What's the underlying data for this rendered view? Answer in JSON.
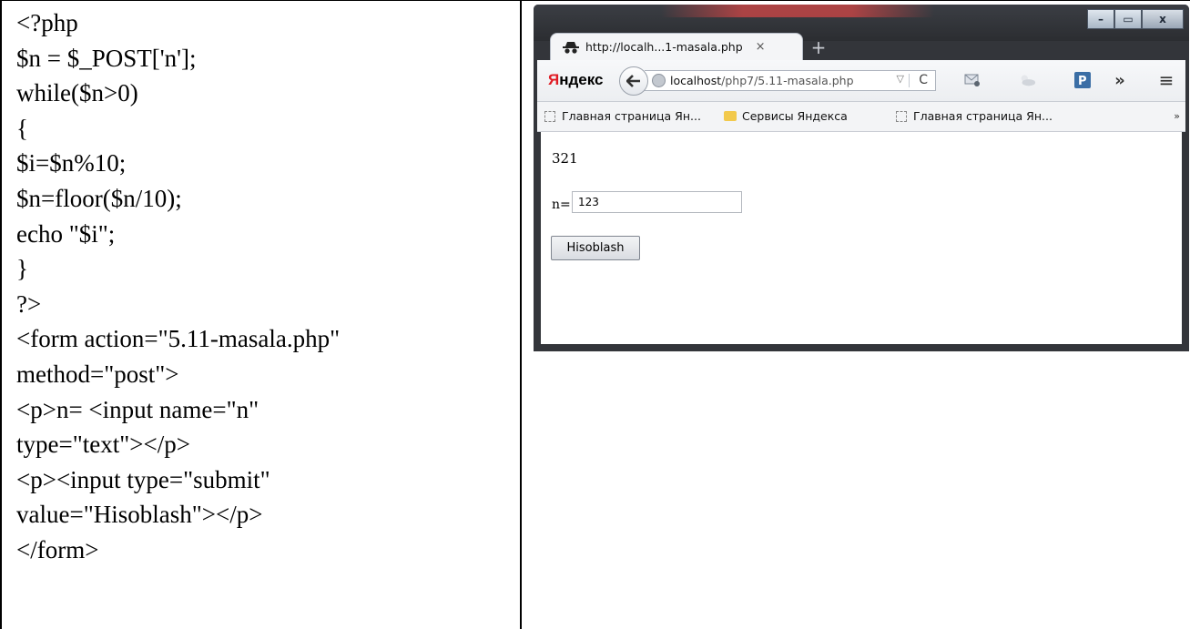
{
  "code": {
    "lines": [
      "<?php",
      "$n = $_POST['n'];",
      "while($n>0)",
      "{",
      "$i=$n%10;",
      "$n=floor($n/10);",
      "echo \"$i\";",
      "}",
      "?>",
      "<form action=\"5.11-masala.php\"",
      "method=\"post\">",
      "<p>n= <input name=\"n\"",
      "type=\"text\"></p>",
      "<p><input type=\"submit\"",
      "value=\"Hisoblash\"></p>",
      "</form>"
    ]
  },
  "browser": {
    "tab_title": "http://localh...1-masala.php",
    "tab_close": "×",
    "new_tab": "+",
    "window_controls": {
      "minimize": "–",
      "maximize": "▭",
      "close": "x"
    },
    "yandex_first": "Я",
    "yandex_rest": "ндекс",
    "url_host": "localhost",
    "url_path": "/php7/5.11-masala.php",
    "url_dropdown": "▽",
    "reload": "C",
    "more": "»",
    "menu": "≡",
    "bookmarks": [
      "Главная страница Ян...",
      "Сервисы Яндекса",
      "Главная страница Ян..."
    ],
    "bookmarks_more": "»",
    "page": {
      "result": "321",
      "n_label": "n=",
      "n_value": "123",
      "submit_label": "Hisoblash"
    }
  },
  "colors": {
    "yandex_red": "#e01b24",
    "browser_frame": "#33353a"
  }
}
